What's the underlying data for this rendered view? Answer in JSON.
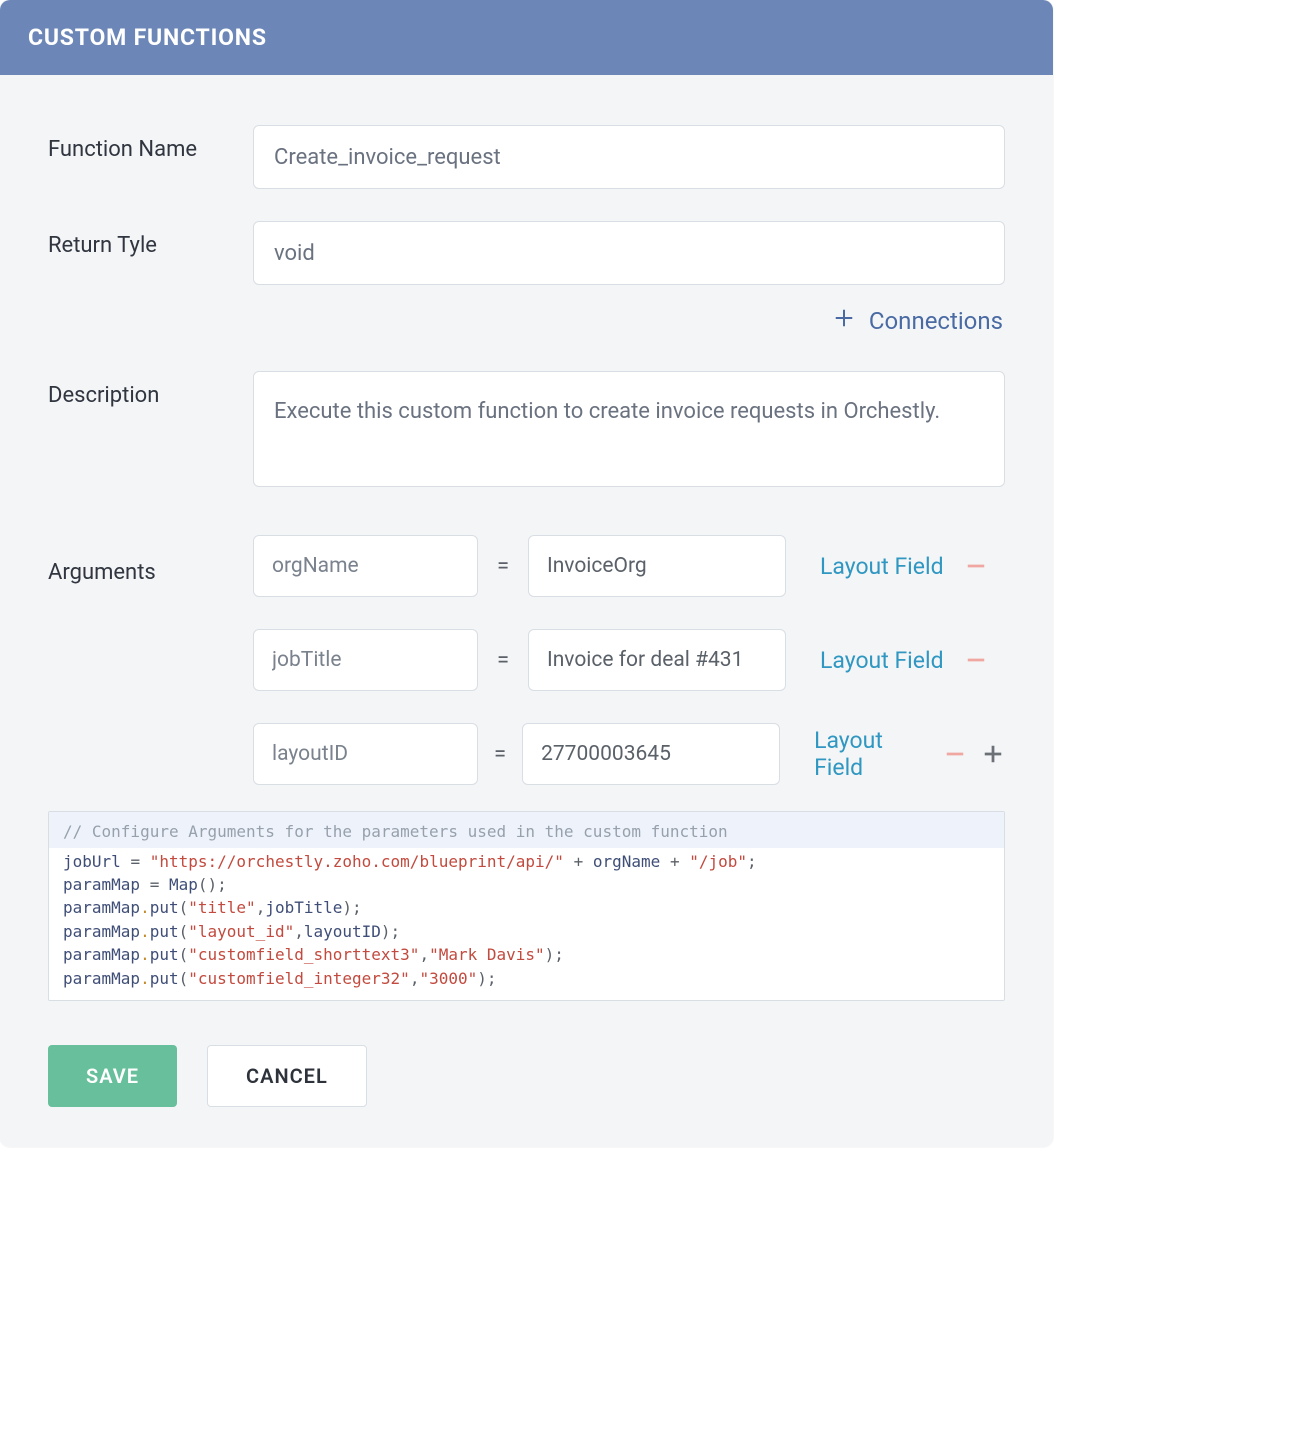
{
  "header": {
    "title": "CUSTOM FUNCTIONS"
  },
  "labels": {
    "function_name": "Function Name",
    "return_type": "Return Tyle",
    "description": "Description",
    "arguments": "Arguments",
    "connections": "Connections",
    "layout_field": "Layout Field",
    "equals": "="
  },
  "fields": {
    "function_name": "Create_invoice_request",
    "return_type": "void",
    "description": "Execute this custom function to create invoice requests in Orchestly."
  },
  "arguments": [
    {
      "name": "orgName",
      "value": "InvoiceOrg",
      "show_add": false
    },
    {
      "name": "jobTitle",
      "value": "Invoice for deal #431",
      "show_add": false
    },
    {
      "name": "layoutID",
      "value": "27700003645",
      "show_add": true
    }
  ],
  "code": {
    "comment": "// Configure Arguments for the parameters used in the custom function",
    "lines": [
      {
        "type": "assign_concat",
        "var": "jobUrl",
        "parts": [
          {
            "kind": "str",
            "text": "\"https://orchestly.zoho.com/blueprint/api/\""
          },
          {
            "kind": "plus"
          },
          {
            "kind": "var",
            "text": "orgName"
          },
          {
            "kind": "plus"
          },
          {
            "kind": "str",
            "text": "\"/job\""
          }
        ]
      },
      {
        "type": "assign_call",
        "var": "paramMap",
        "call": "Map",
        "args": []
      },
      {
        "type": "method",
        "obj": "paramMap",
        "method": "put",
        "args": [
          {
            "kind": "str",
            "text": "\"title\""
          },
          {
            "kind": "var",
            "text": "jobTitle"
          }
        ]
      },
      {
        "type": "method",
        "obj": "paramMap",
        "method": "put",
        "args": [
          {
            "kind": "str",
            "text": "\"layout_id\""
          },
          {
            "kind": "var",
            "text": "layoutID"
          }
        ]
      },
      {
        "type": "method",
        "obj": "paramMap",
        "method": "put",
        "args": [
          {
            "kind": "str",
            "text": "\"customfield_shorttext3\""
          },
          {
            "kind": "str",
            "text": "\"Mark Davis\""
          }
        ]
      },
      {
        "type": "method",
        "obj": "paramMap",
        "method": "put",
        "args": [
          {
            "kind": "str",
            "text": "\"customfield_integer32\""
          },
          {
            "kind": "str",
            "text": "\"3000\""
          }
        ]
      }
    ]
  },
  "buttons": {
    "save": "SAVE",
    "cancel": "CANCEL"
  }
}
